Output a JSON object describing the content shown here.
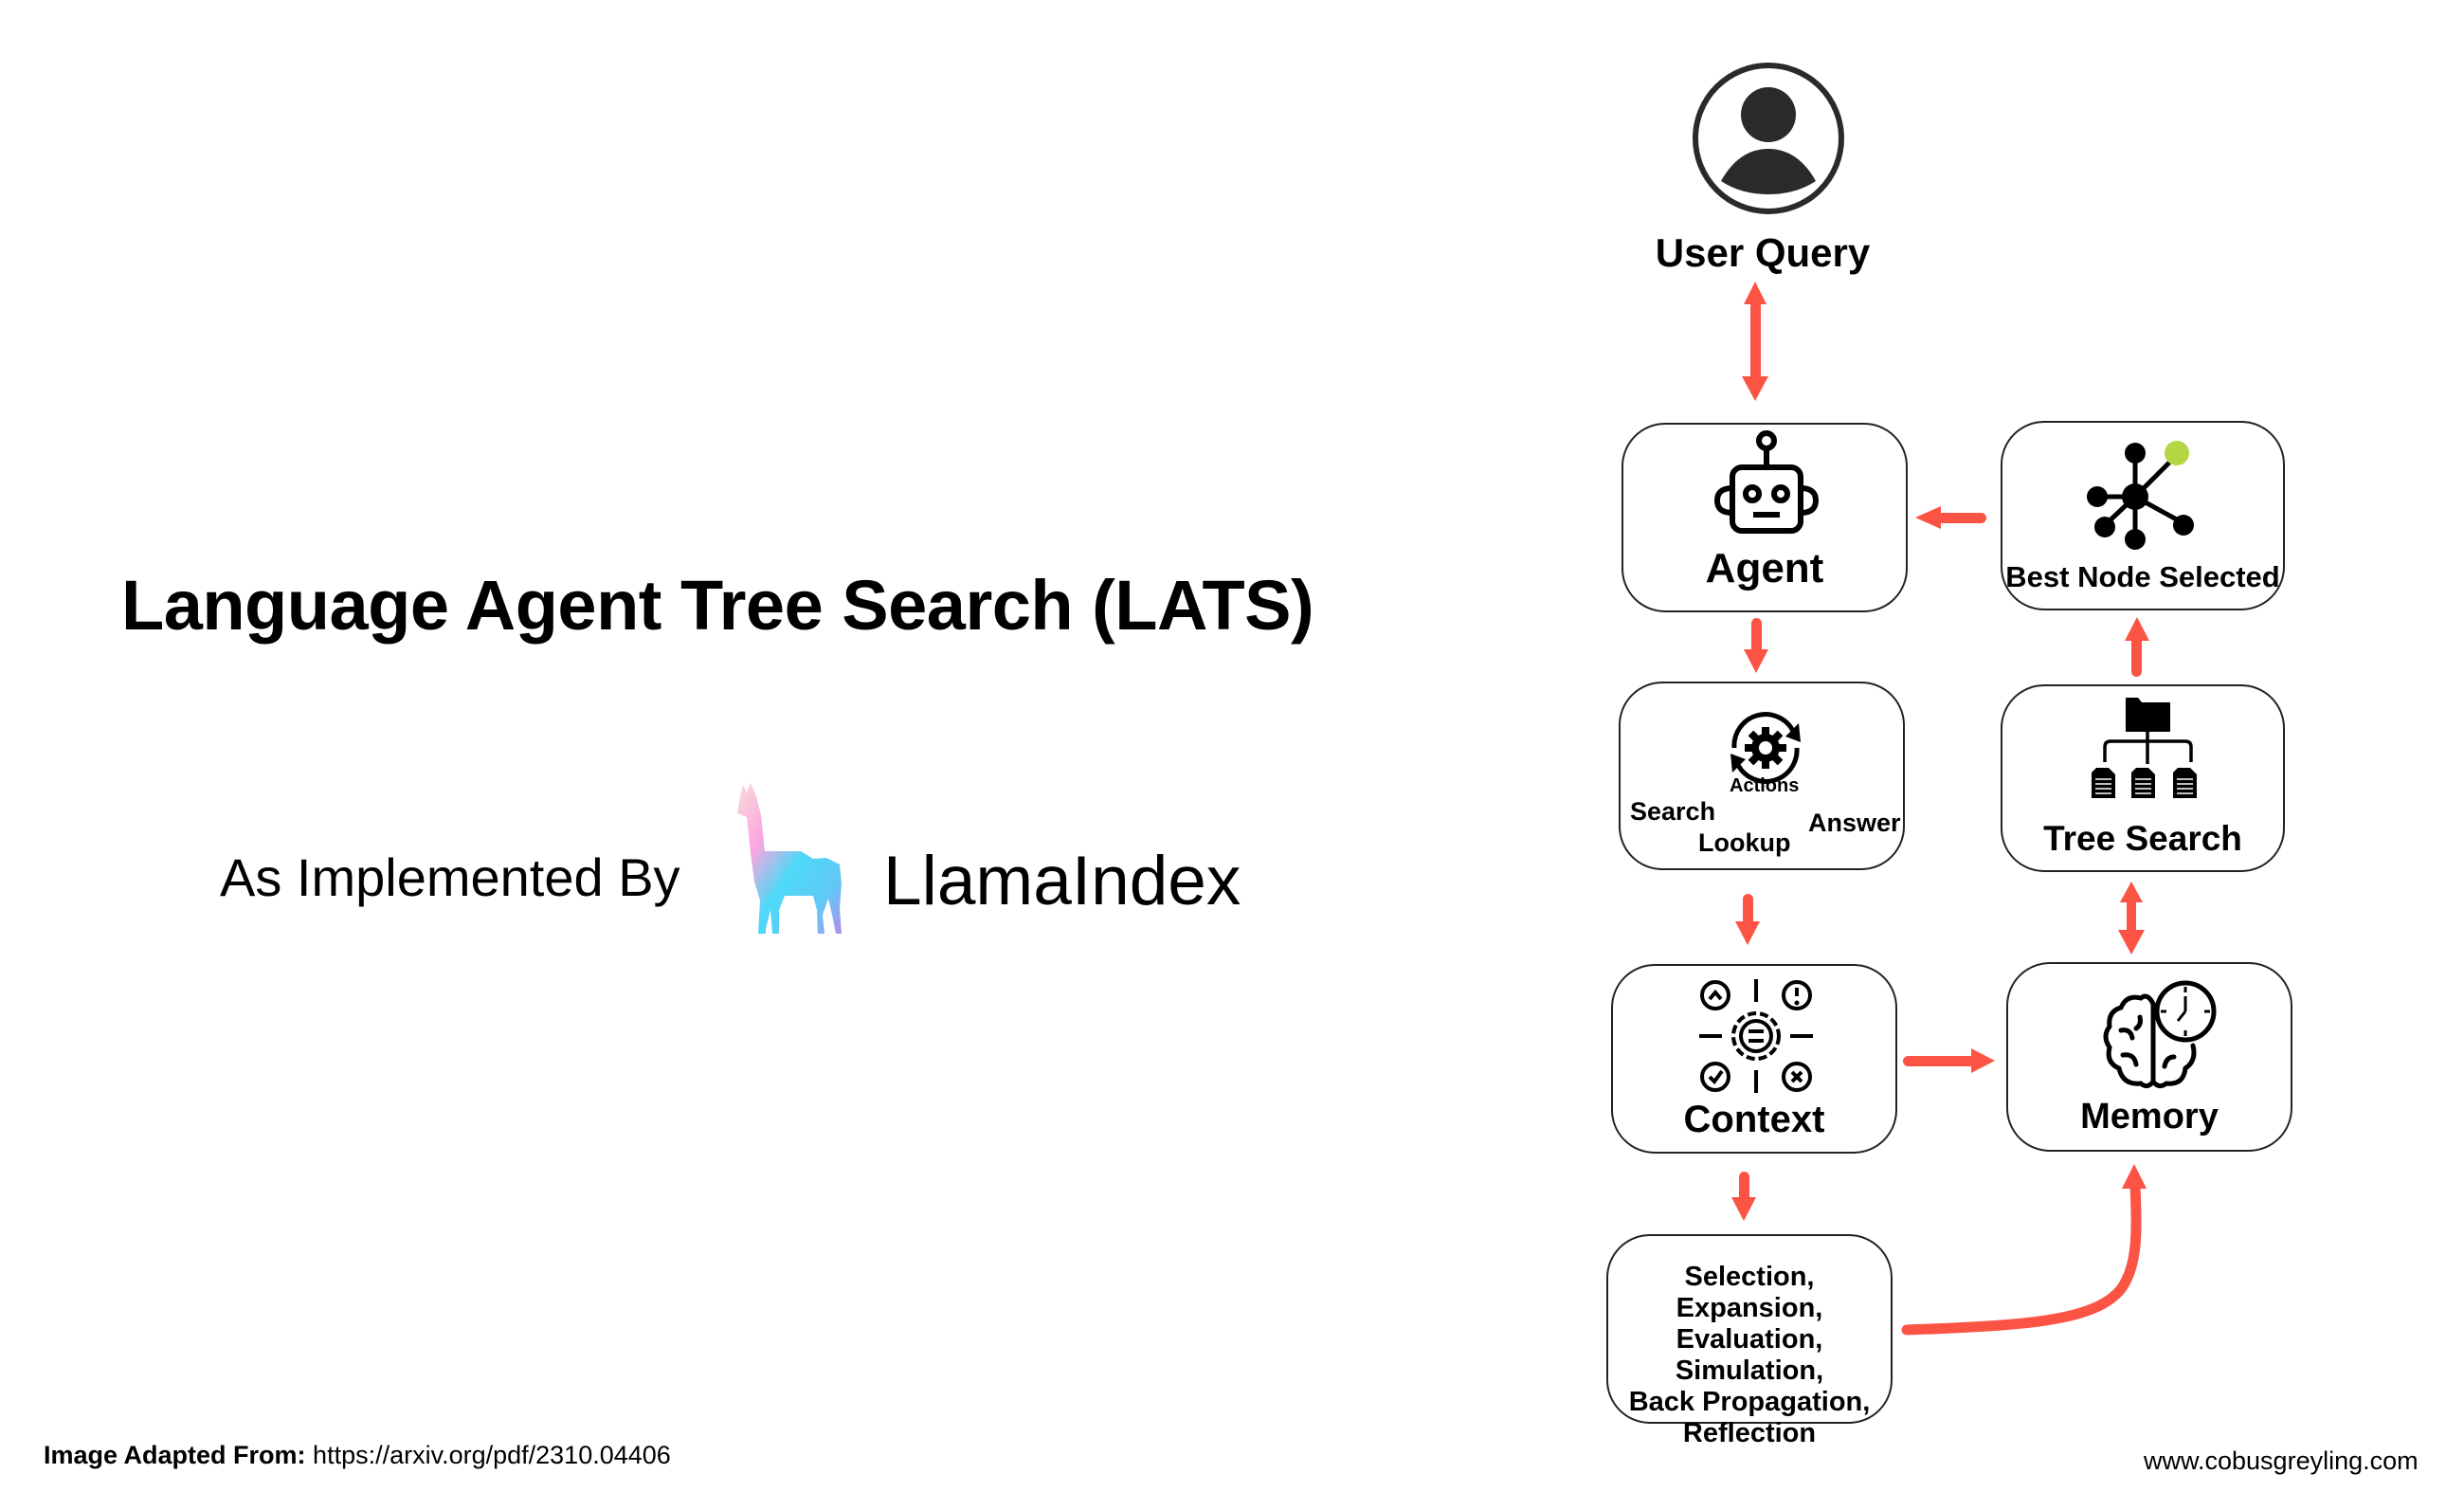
{
  "left_panel": {
    "title": "Language Agent Tree Search (LATS)",
    "implemented_by": "As Implemented By",
    "brand": "LlamaIndex",
    "brand_logo_icon": "llama-logo-icon"
  },
  "footer": {
    "source_label": "Image Adapted From:",
    "source_url": "https://arxiv.org/pdf/2310.04406",
    "website": "www.cobusgreyling.com"
  },
  "diagram": {
    "user_query": {
      "label": "User Query",
      "icon": "user-icon"
    },
    "agent": {
      "label": "Agent",
      "icon": "robot-icon"
    },
    "best_node": {
      "label": "Best Node Selected",
      "icon": "node-graph-icon"
    },
    "actions": {
      "icon": "gear-cycle-icon",
      "caption": "Actions",
      "items": [
        "Search",
        "Lookup",
        "Answer"
      ]
    },
    "tree_search": {
      "label": "Tree Search",
      "icon": "folder-tree-icon"
    },
    "context": {
      "label": "Context",
      "icon": "context-gear-icon"
    },
    "memory": {
      "label": "Memory",
      "icon": "brain-clock-icon"
    },
    "mcts": {
      "lines": [
        "Selection, Expansion,",
        "Evaluation, Simulation,",
        "Back Propagation,",
        "Reflection"
      ]
    },
    "arrow_color": "#fb5445",
    "highlight_node_color": "#b5d643",
    "edges": [
      {
        "from": "User Query",
        "to": "Agent",
        "direction": "both"
      },
      {
        "from": "Best Node Selected",
        "to": "Agent",
        "direction": "forward"
      },
      {
        "from": "Agent",
        "to": "Actions",
        "direction": "forward"
      },
      {
        "from": "Tree Search",
        "to": "Best Node Selected",
        "direction": "forward"
      },
      {
        "from": "Actions",
        "to": "Context",
        "direction": "forward"
      },
      {
        "from": "Tree Search",
        "to": "Memory",
        "direction": "both"
      },
      {
        "from": "Context",
        "to": "Memory",
        "direction": "forward"
      },
      {
        "from": "Context",
        "to": "Selection, Expansion, Evaluation, Simulation, Back Propagation, Reflection",
        "direction": "forward"
      },
      {
        "from": "Selection, Expansion, Evaluation, Simulation, Back Propagation, Reflection",
        "to": "Memory",
        "direction": "forward"
      }
    ]
  }
}
